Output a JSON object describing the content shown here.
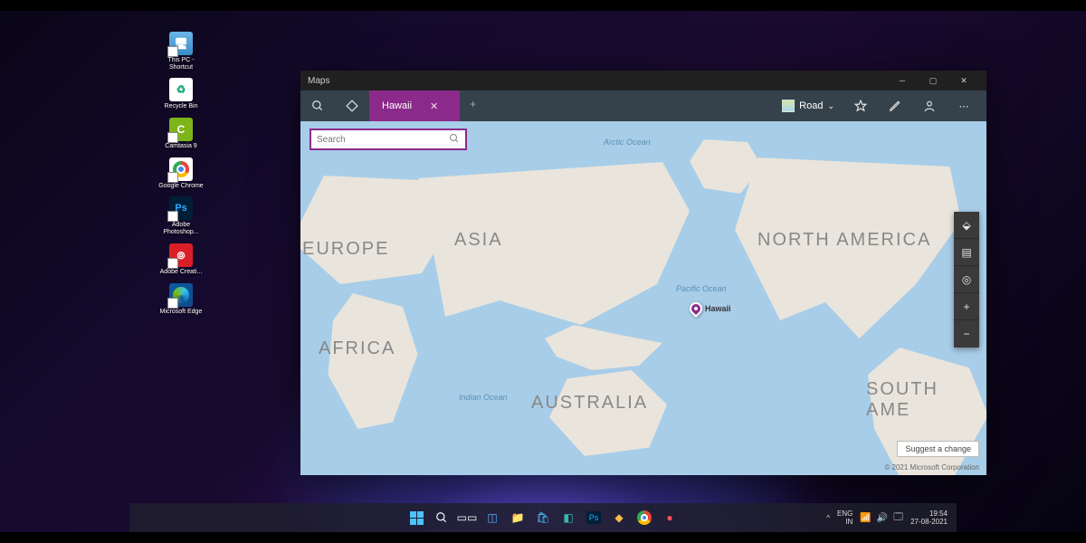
{
  "desktop_icons": [
    {
      "name": "this-pc",
      "label": "This PC - Shortcut"
    },
    {
      "name": "recycle-bin",
      "label": "Recycle Bin"
    },
    {
      "name": "camtasia",
      "label": "Camtasia 9"
    },
    {
      "name": "chrome",
      "label": "Google Chrome"
    },
    {
      "name": "photoshop",
      "label": "Adobe Photoshop...",
      "tile_text": "Ps"
    },
    {
      "name": "creative-cloud",
      "label": "Adobe Creati..."
    },
    {
      "name": "edge",
      "label": "Microsoft Edge"
    }
  ],
  "window": {
    "title": "Maps",
    "tab_label": "Hawaii",
    "search_placeholder": "Search",
    "road_label": "Road",
    "suggest_label": "Suggest a change",
    "copyright": "© 2021 Microsoft Corporation"
  },
  "map": {
    "continents": {
      "europe": "EUROPE",
      "asia": "ASIA",
      "north_america": "NORTH AMERICA",
      "africa": "AFRICA",
      "australia": "AUSTRALIA",
      "south_america": "SOUTH AME"
    },
    "oceans": {
      "arctic": "Arctic Ocean",
      "pacific": "Pacific Ocean",
      "indian": "Indian Ocean"
    },
    "pin_label": "Hawaii"
  },
  "taskbar": {
    "lang_top": "ENG",
    "lang_bottom": "IN",
    "time": "19:54",
    "date": "27-08-2021",
    "chevron": "^"
  }
}
